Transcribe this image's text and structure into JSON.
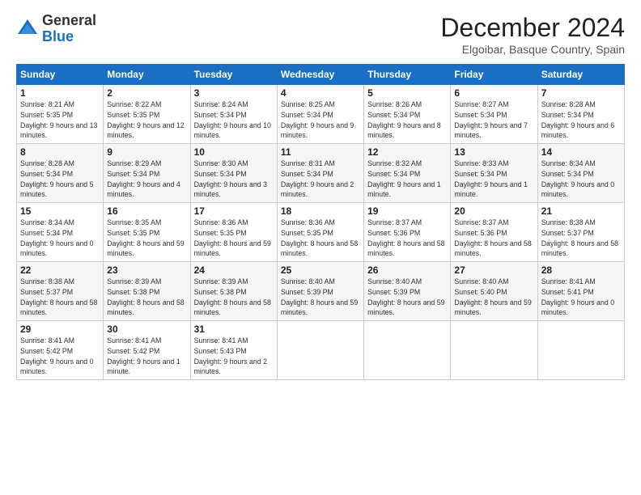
{
  "logo": {
    "general": "General",
    "blue": "Blue"
  },
  "title": "December 2024",
  "location": "Elgoibar, Basque Country, Spain",
  "headers": [
    "Sunday",
    "Monday",
    "Tuesday",
    "Wednesday",
    "Thursday",
    "Friday",
    "Saturday"
  ],
  "weeks": [
    [
      {
        "day": "1",
        "sunrise": "8:21 AM",
        "sunset": "5:35 PM",
        "daylight": "9 hours and 13 minutes."
      },
      {
        "day": "2",
        "sunrise": "8:22 AM",
        "sunset": "5:35 PM",
        "daylight": "9 hours and 12 minutes."
      },
      {
        "day": "3",
        "sunrise": "8:24 AM",
        "sunset": "5:34 PM",
        "daylight": "9 hours and 10 minutes."
      },
      {
        "day": "4",
        "sunrise": "8:25 AM",
        "sunset": "5:34 PM",
        "daylight": "9 hours and 9 minutes."
      },
      {
        "day": "5",
        "sunrise": "8:26 AM",
        "sunset": "5:34 PM",
        "daylight": "9 hours and 8 minutes."
      },
      {
        "day": "6",
        "sunrise": "8:27 AM",
        "sunset": "5:34 PM",
        "daylight": "9 hours and 7 minutes."
      },
      {
        "day": "7",
        "sunrise": "8:28 AM",
        "sunset": "5:34 PM",
        "daylight": "9 hours and 6 minutes."
      }
    ],
    [
      {
        "day": "8",
        "sunrise": "8:28 AM",
        "sunset": "5:34 PM",
        "daylight": "9 hours and 5 minutes."
      },
      {
        "day": "9",
        "sunrise": "8:29 AM",
        "sunset": "5:34 PM",
        "daylight": "9 hours and 4 minutes."
      },
      {
        "day": "10",
        "sunrise": "8:30 AM",
        "sunset": "5:34 PM",
        "daylight": "9 hours and 3 minutes."
      },
      {
        "day": "11",
        "sunrise": "8:31 AM",
        "sunset": "5:34 PM",
        "daylight": "9 hours and 2 minutes."
      },
      {
        "day": "12",
        "sunrise": "8:32 AM",
        "sunset": "5:34 PM",
        "daylight": "9 hours and 1 minute."
      },
      {
        "day": "13",
        "sunrise": "8:33 AM",
        "sunset": "5:34 PM",
        "daylight": "9 hours and 1 minute."
      },
      {
        "day": "14",
        "sunrise": "8:34 AM",
        "sunset": "5:34 PM",
        "daylight": "9 hours and 0 minutes."
      }
    ],
    [
      {
        "day": "15",
        "sunrise": "8:34 AM",
        "sunset": "5:34 PM",
        "daylight": "9 hours and 0 minutes."
      },
      {
        "day": "16",
        "sunrise": "8:35 AM",
        "sunset": "5:35 PM",
        "daylight": "8 hours and 59 minutes."
      },
      {
        "day": "17",
        "sunrise": "8:36 AM",
        "sunset": "5:35 PM",
        "daylight": "8 hours and 59 minutes."
      },
      {
        "day": "18",
        "sunrise": "8:36 AM",
        "sunset": "5:35 PM",
        "daylight": "8 hours and 58 minutes."
      },
      {
        "day": "19",
        "sunrise": "8:37 AM",
        "sunset": "5:36 PM",
        "daylight": "8 hours and 58 minutes."
      },
      {
        "day": "20",
        "sunrise": "8:37 AM",
        "sunset": "5:36 PM",
        "daylight": "8 hours and 58 minutes."
      },
      {
        "day": "21",
        "sunrise": "8:38 AM",
        "sunset": "5:37 PM",
        "daylight": "8 hours and 58 minutes."
      }
    ],
    [
      {
        "day": "22",
        "sunrise": "8:38 AM",
        "sunset": "5:37 PM",
        "daylight": "8 hours and 58 minutes."
      },
      {
        "day": "23",
        "sunrise": "8:39 AM",
        "sunset": "5:38 PM",
        "daylight": "8 hours and 58 minutes."
      },
      {
        "day": "24",
        "sunrise": "8:39 AM",
        "sunset": "5:38 PM",
        "daylight": "8 hours and 58 minutes."
      },
      {
        "day": "25",
        "sunrise": "8:40 AM",
        "sunset": "5:39 PM",
        "daylight": "8 hours and 59 minutes."
      },
      {
        "day": "26",
        "sunrise": "8:40 AM",
        "sunset": "5:39 PM",
        "daylight": "8 hours and 59 minutes."
      },
      {
        "day": "27",
        "sunrise": "8:40 AM",
        "sunset": "5:40 PM",
        "daylight": "8 hours and 59 minutes."
      },
      {
        "day": "28",
        "sunrise": "8:41 AM",
        "sunset": "5:41 PM",
        "daylight": "9 hours and 0 minutes."
      }
    ],
    [
      {
        "day": "29",
        "sunrise": "8:41 AM",
        "sunset": "5:42 PM",
        "daylight": "9 hours and 0 minutes."
      },
      {
        "day": "30",
        "sunrise": "8:41 AM",
        "sunset": "5:42 PM",
        "daylight": "9 hours and 1 minute."
      },
      {
        "day": "31",
        "sunrise": "8:41 AM",
        "sunset": "5:43 PM",
        "daylight": "9 hours and 2 minutes."
      },
      null,
      null,
      null,
      null
    ]
  ]
}
